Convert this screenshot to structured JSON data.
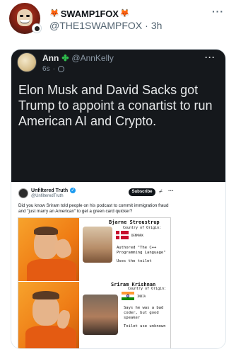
{
  "post": {
    "display_name": "SWAMP1FOX",
    "handle": "@THE1SWAMPFOX",
    "separator": "·",
    "time": "3h",
    "more": "···"
  },
  "embedded_tweet": {
    "name": "Ann",
    "name_emoji": "✤",
    "handle": "@AnnKelly",
    "time": "6s",
    "separator": "·",
    "more": "···",
    "text": "Elon Musk and David Sacks got Trump to appoint a conartist to run American AI and Crypto."
  },
  "quoted_card": {
    "account_name": "Unfiltered Truth",
    "account_handle": "@UnfilteredTruth",
    "subscribe_label": "Subscribe",
    "more": "···",
    "text": "Did you know Sriram told people on his podcast to commit immigration fraud and \"just marry an American\" to get a green card quicker?"
  },
  "meme": {
    "top": {
      "name": "Bjarne Stroustrup",
      "origin_label": "Country of Origin:",
      "country": "DENMARK",
      "authored": "Authored \"The C++ Programming Language\"",
      "toilet": "Uses the toilet"
    },
    "bottom": {
      "name": "Sriram Krishnan",
      "origin_label": "Country of Origin:",
      "country": "INDIA",
      "said": "Says he was a bad coder, but good speaker",
      "toilet": "Toilet use unknown"
    }
  }
}
